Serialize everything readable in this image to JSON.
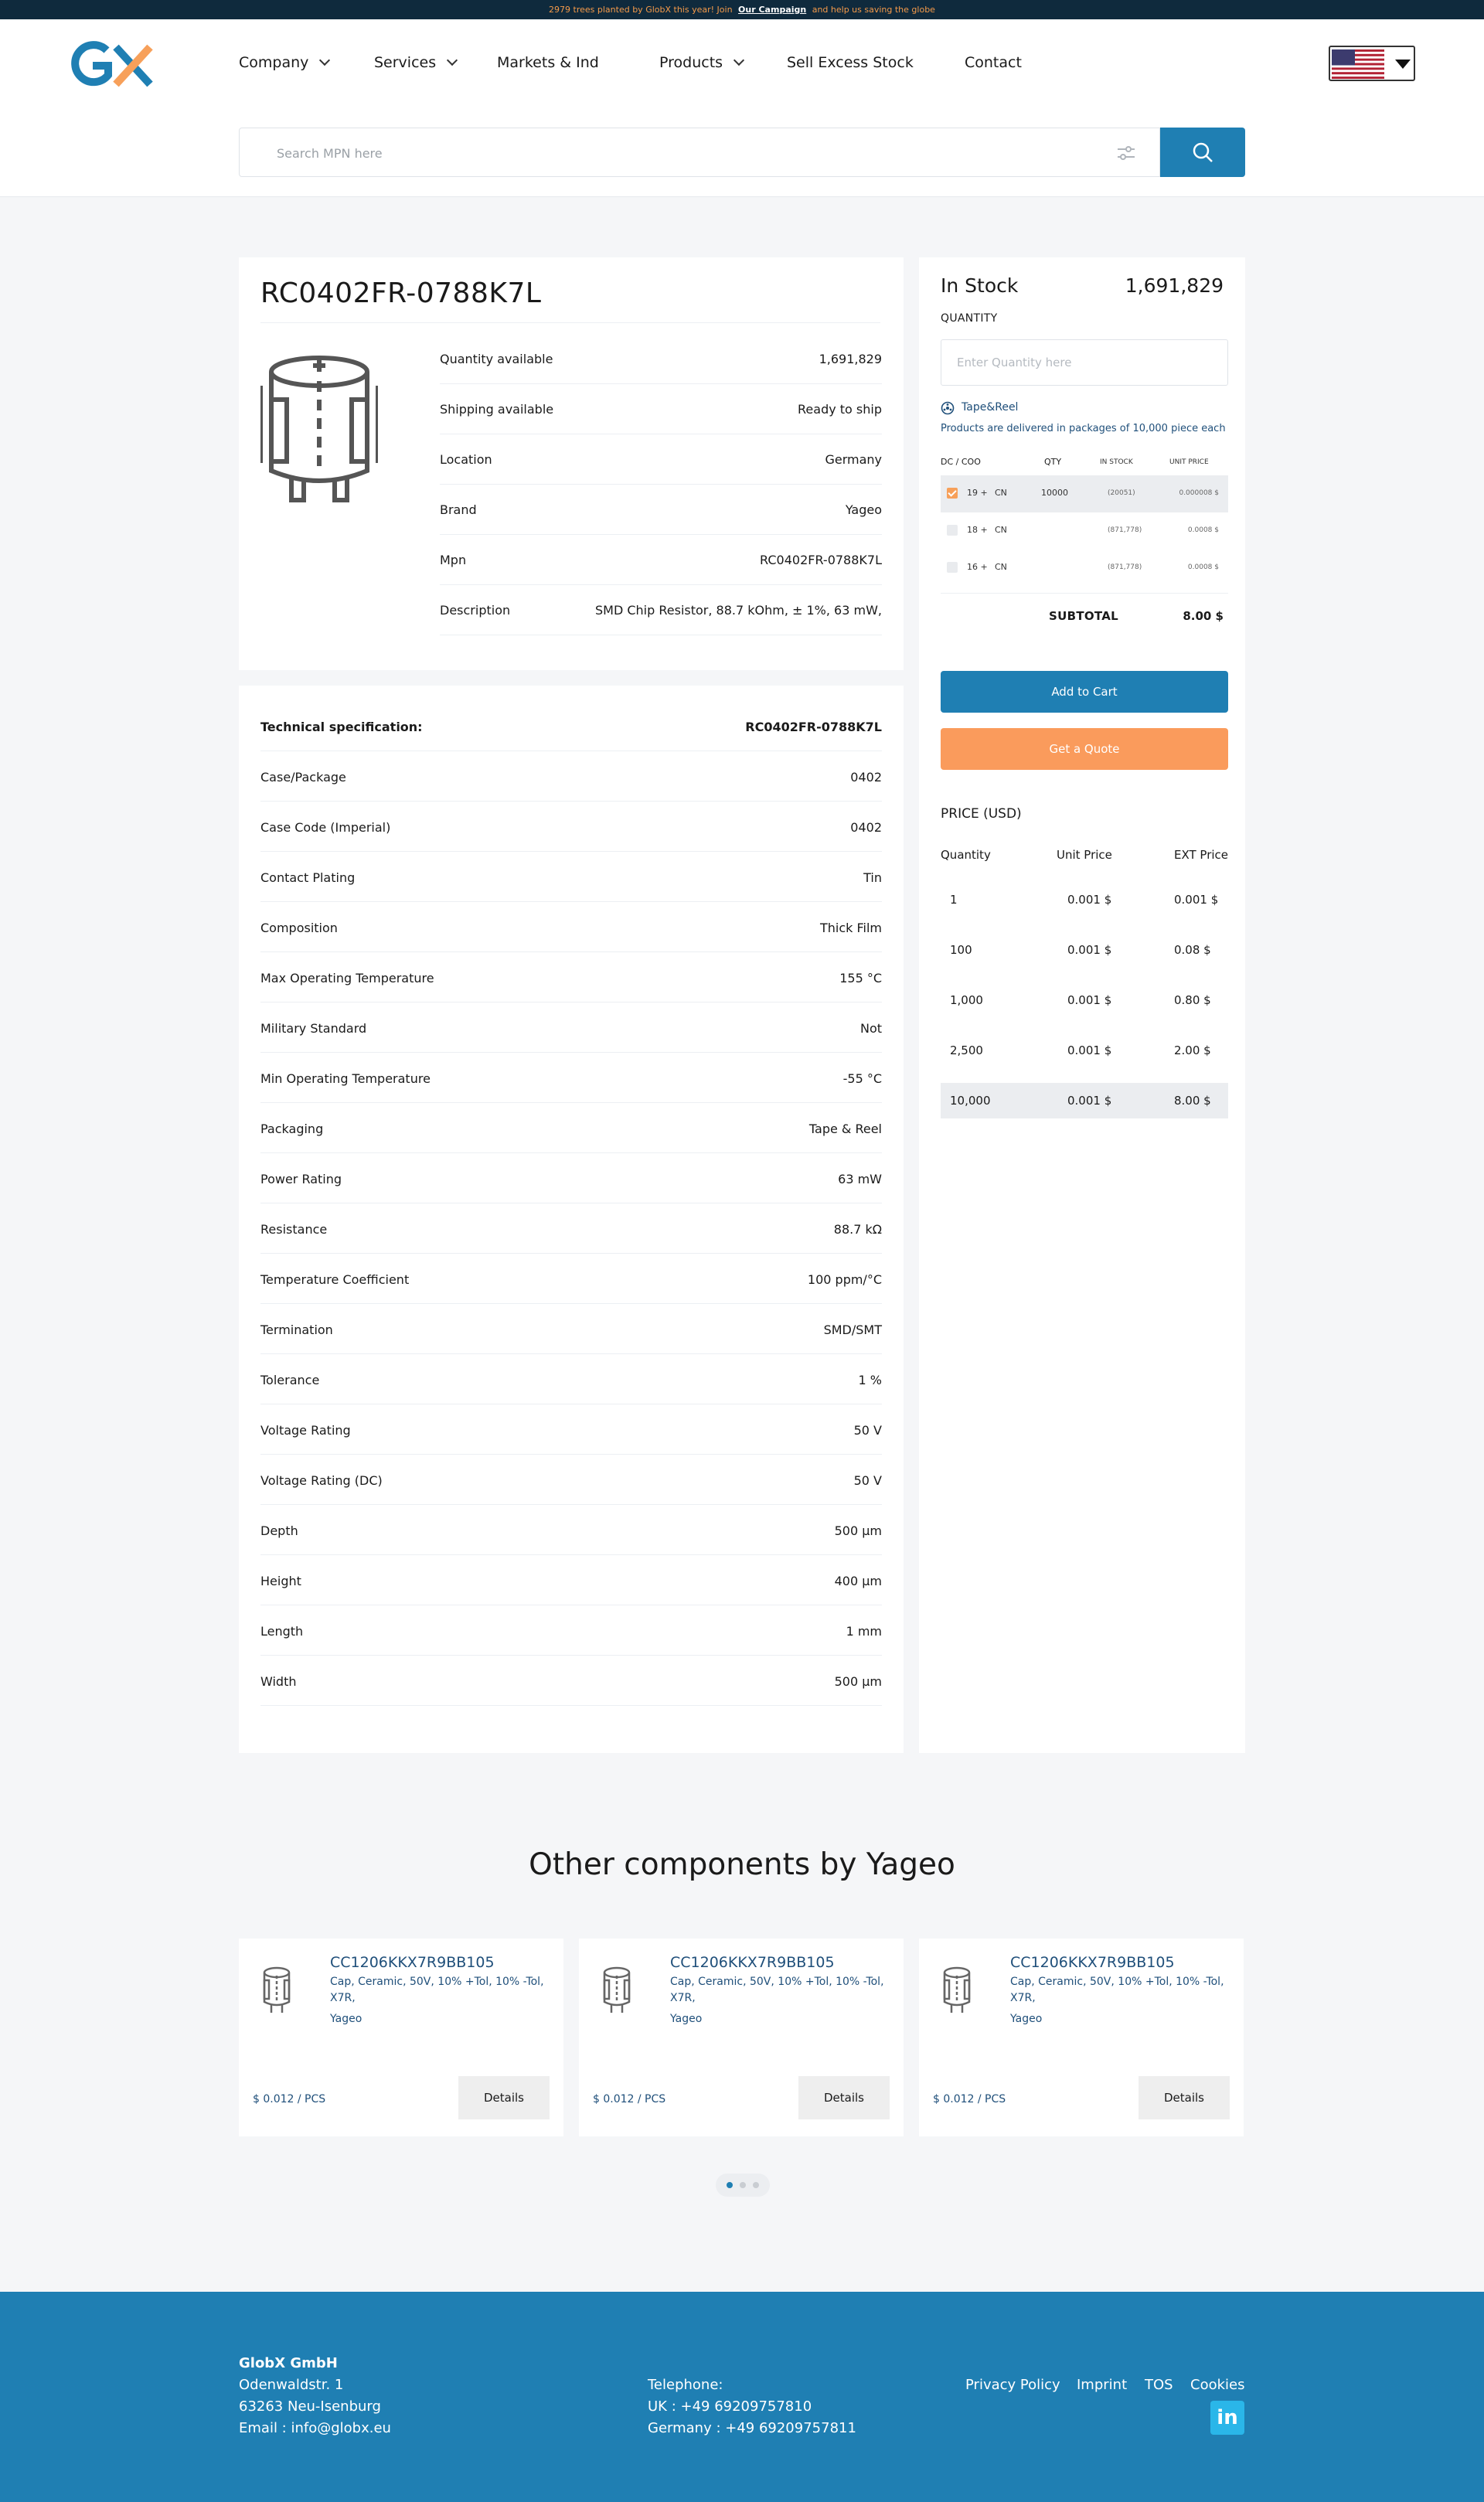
{
  "banner": {
    "text_before": "2979 trees planted by GlobX this year! Join",
    "link": "Our Campaign",
    "text_after": "and help us saving the globe"
  },
  "nav": {
    "company": "Company",
    "services": "Services",
    "markets": "Markets & Ind",
    "products": "Products",
    "sell": "Sell Excess Stock",
    "contact": "Contact"
  },
  "search": {
    "placeholder": "Search MPN here"
  },
  "product": {
    "mpn": "RC0402FR-0788K7L",
    "info": [
      {
        "label": "Quantity available",
        "value": "1,691,829"
      },
      {
        "label": "Shipping available",
        "value": "Ready to ship"
      },
      {
        "label": "Location",
        "value": "Germany"
      },
      {
        "label": "Brand",
        "value": "Yageo"
      },
      {
        "label": "Mpn",
        "value": "RC0402FR-0788K7L"
      },
      {
        "label": "Description",
        "value": "SMD Chip Resistor, 88.7 kOhm, ± 1%, 63 mW,"
      }
    ]
  },
  "spec": {
    "heading": "Technical specification:",
    "heading_value": "RC0402FR-0788K7L",
    "rows": [
      {
        "label": "Case/Package",
        "value": "0402"
      },
      {
        "label": "Case Code (Imperial)",
        "value": "0402"
      },
      {
        "label": "Contact Plating",
        "value": "Tin"
      },
      {
        "label": "Composition",
        "value": "Thick Film"
      },
      {
        "label": "Max Operating Temperature",
        "value": "155 °C"
      },
      {
        "label": "Military Standard",
        "value": "Not"
      },
      {
        "label": "Min Operating Temperature",
        "value": "-55 °C"
      },
      {
        "label": "Packaging",
        "value": "Tape & Reel"
      },
      {
        "label": "Power Rating",
        "value": "63 mW"
      },
      {
        "label": "Resistance",
        "value": "88.7 kΩ"
      },
      {
        "label": "Temperature Coefficient",
        "value": "100 ppm/°C"
      },
      {
        "label": "Termination",
        "value": "SMD/SMT"
      },
      {
        "label": "Tolerance",
        "value": "1 %"
      },
      {
        "label": "Voltage Rating",
        "value": "50 V"
      },
      {
        "label": "Voltage Rating (DC)",
        "value": "50 V"
      },
      {
        "label": "Depth",
        "value": "500 µm"
      },
      {
        "label": "Height",
        "value": "400 µm"
      },
      {
        "label": "Length",
        "value": "1 mm"
      },
      {
        "label": "Width",
        "value": "500 µm"
      }
    ]
  },
  "order": {
    "stock_label": "In Stock",
    "stock_value": "1,691,829",
    "quantity_label": "QUANTITY",
    "quantity_placeholder": "Enter Quantity here",
    "packaging_type": "Tape&Reel",
    "package_note": "Products are delivered in packages of 10,000 piece each",
    "table_headers": {
      "dc": "DC / COO",
      "qty": "QTY",
      "stock": "IN STOCK",
      "unit": "UNIT PRICE"
    },
    "lots": [
      {
        "dc": "19 +",
        "coo": "CN",
        "qty": "10000",
        "stock": "(20051)",
        "unit": "0.000008 $",
        "selected": true
      },
      {
        "dc": "18 +",
        "coo": "CN",
        "qty": "",
        "stock": "(871,778)",
        "unit": "0.0008 $",
        "selected": false
      },
      {
        "dc": "16 +",
        "coo": "CN",
        "qty": "",
        "stock": "(871,778)",
        "unit": "0.0008 $",
        "selected": false
      }
    ],
    "subtotal_label": "SUBTOTAL",
    "subtotal_value": "8.00 $",
    "add_to_cart": "Add to Cart",
    "get_quote": "Get a Quote",
    "price_title": "PRICE (USD)",
    "price_headers": {
      "qty": "Quantity",
      "unit": "Unit Price",
      "ext": "EXT Price"
    },
    "prices": [
      {
        "qty": "1",
        "unit": "0.001 $",
        "ext": "0.001 $"
      },
      {
        "qty": "100",
        "unit": "0.001 $",
        "ext": "0.08 $"
      },
      {
        "qty": "1,000",
        "unit": "0.001 $",
        "ext": "0.80 $"
      },
      {
        "qty": "2,500",
        "unit": "0.001 $",
        "ext": "2.00 $"
      },
      {
        "qty": "10,000",
        "unit": "0.001 $",
        "ext": "8.00 $"
      }
    ]
  },
  "other": {
    "title": "Other components by Yageo",
    "cards": [
      {
        "mpn": "CC1206KKX7R9BB105",
        "desc": "Cap, Ceramic, 50V, 10% +Tol, 10% -Tol, X7R,",
        "brand": "Yageo",
        "price": "$ 0.012 / PCS",
        "button": "Details"
      },
      {
        "mpn": "CC1206KKX7R9BB105",
        "desc": "Cap, Ceramic, 50V, 10% +Tol, 10% -Tol, X7R,",
        "brand": "Yageo",
        "price": "$ 0.012 / PCS",
        "button": "Details"
      },
      {
        "mpn": "CC1206KKX7R9BB105",
        "desc": "Cap, Ceramic, 50V, 10% +Tol, 10% -Tol, X7R,",
        "brand": "Yageo",
        "price": "$ 0.012 / PCS",
        "button": "Details"
      }
    ]
  },
  "footer": {
    "company": "GlobX GmbH",
    "street": "Odenwaldstr. 1",
    "city": "63263 Neu-Isenburg",
    "email": "Email : info@globx.eu",
    "tel_label": "Telephone:",
    "tel_uk": "UK : +49 69209757810",
    "tel_de": "Germany : +49 69209757811",
    "links": {
      "privacy": "Privacy Policy",
      "imprint": "Imprint",
      "tos": "TOS",
      "cookies": "Cookies"
    },
    "social": "in"
  },
  "colors": {
    "primary": "#1f7fb3",
    "accent": "#fa9b5c",
    "dark": "#0f2a3d"
  }
}
